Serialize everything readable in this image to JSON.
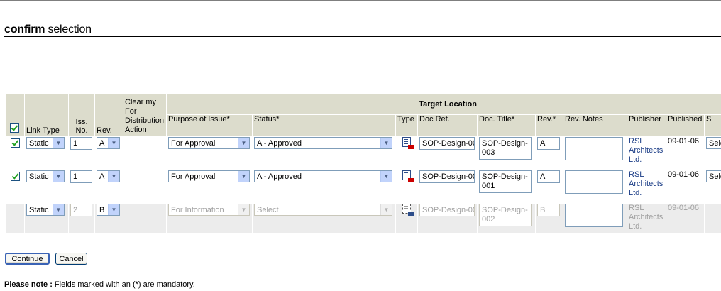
{
  "page": {
    "title_bold": "confirm",
    "title_rest": " selection"
  },
  "table": {
    "target_location_label": "Target Location",
    "headers": {
      "link_type": "Link Type",
      "iss_no": "Iss. No.",
      "rev": "Rev.",
      "clear": "Clear my For Distribution Action",
      "purpose": "Purpose of Issue*",
      "status": "Status*",
      "type": "Type",
      "doc_ref": "Doc Ref.",
      "doc_title": "Doc. Title*",
      "rev2": "Rev.*",
      "rev_notes": "Rev. Notes",
      "publisher": "Publisher",
      "published": "Published",
      "last": "S"
    },
    "rows": [
      {
        "checked": true,
        "link_type": "Static",
        "iss_no": "1",
        "rev": "A",
        "purpose": "For Approval",
        "status": "A - Approved",
        "doc_ref": "SOP-Design-00",
        "doc_title": "SOP-Design-003",
        "rev2": "A",
        "rev_notes": "",
        "publisher": "RSL Architects Ltd.",
        "published": "09-01-06",
        "last": "Sele"
      },
      {
        "checked": true,
        "link_type": "Static",
        "iss_no": "1",
        "rev": "A",
        "purpose": "For Approval",
        "status": "A - Approved",
        "doc_ref": "SOP-Design-00",
        "doc_title": "SOP-Design-001",
        "rev2": "A",
        "rev_notes": "",
        "publisher": "RSL Architects Ltd.",
        "published": "09-01-06",
        "last": "Sele"
      },
      {
        "checked": false,
        "link_type": "Static",
        "iss_no": "2",
        "rev": "B",
        "purpose": "For Information",
        "status": "Select",
        "doc_ref": "SOP-Design-00",
        "doc_title": "SOP-Design-002",
        "rev2": "B",
        "rev_notes": "",
        "publisher": "RSL Architects Ltd.",
        "published": "09-01-06",
        "last": ""
      }
    ]
  },
  "buttons": {
    "continue": "Continue",
    "cancel": "Cancel"
  },
  "note": {
    "label": "Please note :",
    "text": " Fields marked with an (*) are mandatory."
  },
  "colors": {
    "header_bg": "#dcdccc",
    "link": "#1a3c86",
    "check": "#21a121"
  },
  "icons": {
    "type_icon": "document-pdf-icon",
    "dropdown": "chevron-down-icon"
  }
}
